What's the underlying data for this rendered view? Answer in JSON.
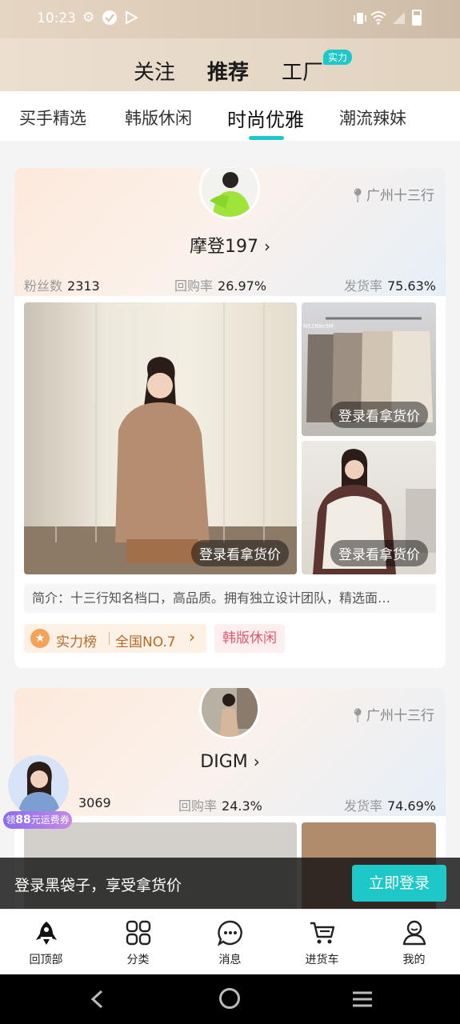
{
  "status_bar": {
    "time": "10:23"
  },
  "top_tabs": {
    "follow": "关注",
    "recommend": "推荐",
    "factory": "工厂",
    "factory_badge": "实力"
  },
  "sub_tabs": [
    "买手精选",
    "韩版休闲",
    "时尚优雅",
    "潮流辣妹"
  ],
  "accent_color": "#1ec8c8",
  "shops": [
    {
      "location": "广州十三行",
      "name": "摩登197",
      "fans_label": "粉丝数",
      "fans": "2313",
      "repurchase_label": "回购率",
      "repurchase": "26.97%",
      "ship_label": "发货率",
      "ship": "75.63%",
      "price_badge": "登录看拿货价",
      "intro": "简介：十三行知名档口，高品质。拥有独立设计团队，精选面…",
      "rank_label": "实力榜",
      "rank_value": "全国NO.7",
      "tag": "韩版休闲"
    },
    {
      "location": "广州十三行",
      "name": "DIGM",
      "fans": "3069",
      "repurchase_label": "回购率",
      "repurchase": "24.3%",
      "ship_label": "发货率",
      "ship": "74.69%"
    }
  ],
  "coupon": {
    "prefix": "领",
    "amount": "88",
    "suffix": "元运费券"
  },
  "login_banner": {
    "text": "登录黑袋子，享受拿货价",
    "button": "立即登录"
  },
  "bottom_nav": [
    "回顶部",
    "分类",
    "消息",
    "进货车",
    "我的"
  ]
}
